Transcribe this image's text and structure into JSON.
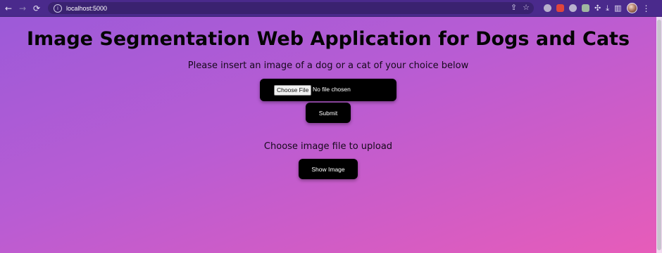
{
  "browser": {
    "url": "localhost:5000",
    "nav": {
      "back_icon": "←",
      "forward_icon": "→",
      "reload_icon": "⟳"
    },
    "omnibox_icons": {
      "info_icon": "i",
      "share_icon": "⇪",
      "bookmark_icon": "☆"
    },
    "extensions": [
      {
        "name": "ext-grey-circle",
        "color": "#b8b0cc"
      },
      {
        "name": "ext-red-flag",
        "color": "#e0453c"
      },
      {
        "name": "ext-bulb",
        "color": "#b9b2cf"
      },
      {
        "name": "ext-green-square",
        "color": "#9fb7a0"
      }
    ],
    "toolbar_icons": {
      "puzzle_icon": "✣",
      "download_icon": "⤓",
      "sidepanel_icon": "▥",
      "menu_icon": "⋮"
    }
  },
  "page": {
    "title": "Image Segmentation Web Application for Dogs and Cats",
    "subtitle": "Please insert an image of a dog or a cat of your choice below",
    "file_input": {
      "button_label": "Choose File",
      "status": "No file chosen"
    },
    "submit_label": "Submit",
    "upload_label": "Choose image file to upload",
    "show_image_label": "Show Image"
  },
  "colors": {
    "background_start": "#9a5ad9",
    "background_end": "#e75cb9",
    "button_bg": "#000000",
    "button_text": "#ffffff"
  }
}
